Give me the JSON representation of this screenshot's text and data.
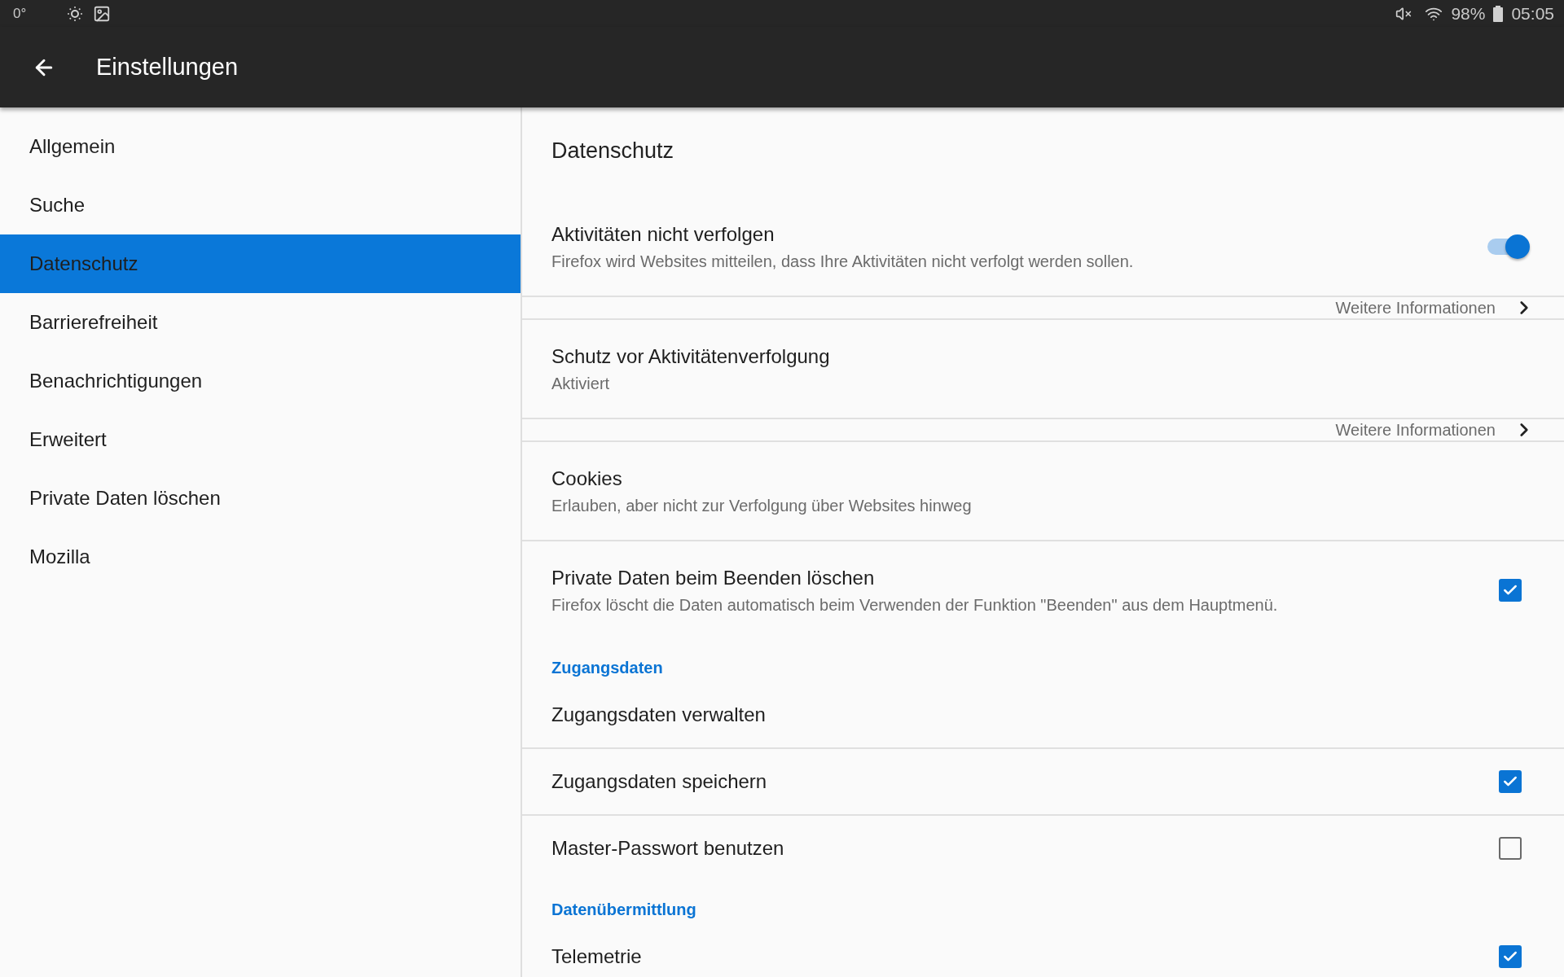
{
  "status_bar": {
    "temperature": "0°",
    "battery": "98%",
    "time": "05:05"
  },
  "toolbar": {
    "title": "Einstellungen"
  },
  "sidebar": {
    "items": [
      {
        "label": "Allgemein",
        "selected": false
      },
      {
        "label": "Suche",
        "selected": false
      },
      {
        "label": "Datenschutz",
        "selected": true
      },
      {
        "label": "Barrierefreiheit",
        "selected": false
      },
      {
        "label": "Benachrichtigungen",
        "selected": false
      },
      {
        "label": "Erweitert",
        "selected": false
      },
      {
        "label": "Private Daten löschen",
        "selected": false
      },
      {
        "label": "Mozilla",
        "selected": false
      }
    ]
  },
  "content": {
    "title": "Datenschutz",
    "items": [
      {
        "kind": "switch",
        "title": "Aktivitäten nicht verfolgen",
        "subtitle": "Firefox wird Websites mitteilen, dass Ihre Aktivitäten nicht verfolgt werden sollen.",
        "on": true
      },
      {
        "kind": "more",
        "label": "Weitere Informationen"
      },
      {
        "kind": "plain",
        "title": "Schutz vor Aktivitätenverfolgung",
        "subtitle": "Aktiviert"
      },
      {
        "kind": "more",
        "label": "Weitere Informationen"
      },
      {
        "kind": "plain",
        "title": "Cookies",
        "subtitle": "Erlauben, aber nicht zur Verfolgung über Websites hinweg"
      },
      {
        "kind": "checkbox",
        "title": "Private Daten beim Beenden löschen",
        "subtitle": "Firefox löscht die Daten automatisch beim Verwenden der Funktion \"Beenden\" aus dem Hauptmenü.",
        "checked": true
      },
      {
        "kind": "section",
        "title": "Zugangsdaten"
      },
      {
        "kind": "plain",
        "title": "Zugangsdaten verwalten"
      },
      {
        "kind": "checkbox",
        "title": "Zugangsdaten speichern",
        "checked": true
      },
      {
        "kind": "checkbox",
        "title": "Master-Passwort benutzen",
        "checked": false
      },
      {
        "kind": "section",
        "title": "Datenübermittlung"
      },
      {
        "kind": "checkbox",
        "title": "Telemetrie",
        "checked": true
      }
    ]
  }
}
